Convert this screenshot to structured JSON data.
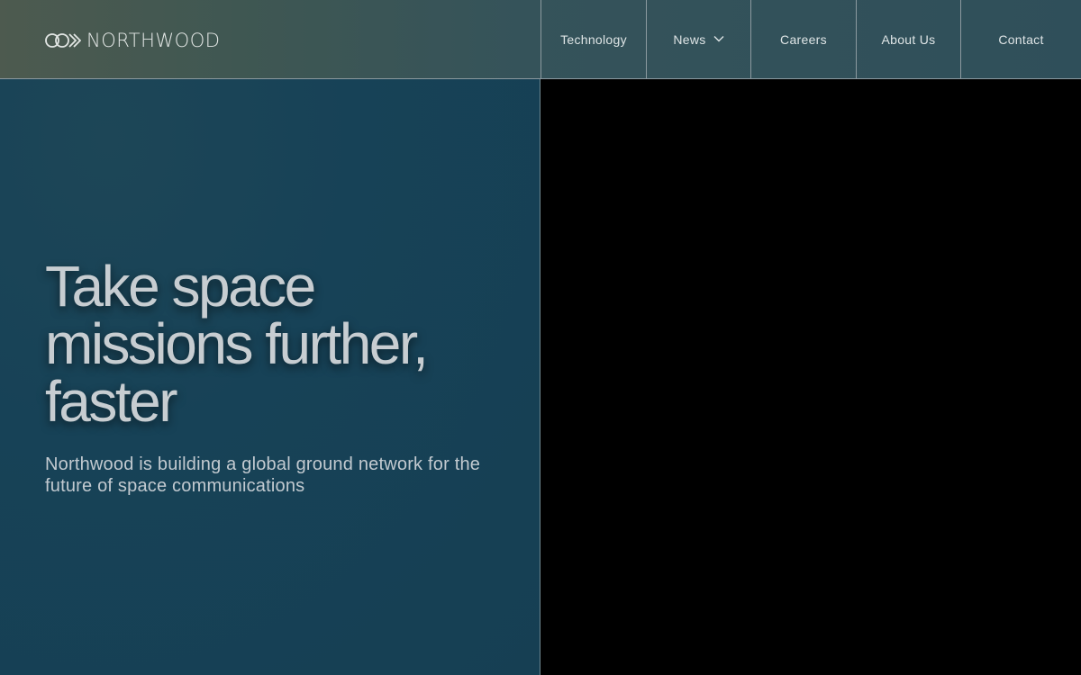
{
  "brand": {
    "name": "NORTHWOOD",
    "logo_icon": "northwood-rings-icon"
  },
  "nav": {
    "items": [
      {
        "label": "Technology"
      },
      {
        "label": "News",
        "icon": "chevron-down-icon"
      },
      {
        "label": "Careers"
      },
      {
        "label": "About Us"
      },
      {
        "label": "Contact"
      }
    ]
  },
  "hero": {
    "title_lines": [
      "Take space",
      "missions further,",
      "faster"
    ],
    "subtitle": "Northwood is building a global ground network for the future of space communications"
  },
  "colors": {
    "header_bg": "#3a5556",
    "hero_bg": "#174257",
    "right_panel_bg": "#000000",
    "text_light": "#c7cdd1",
    "divider": "#8c9aa0"
  }
}
